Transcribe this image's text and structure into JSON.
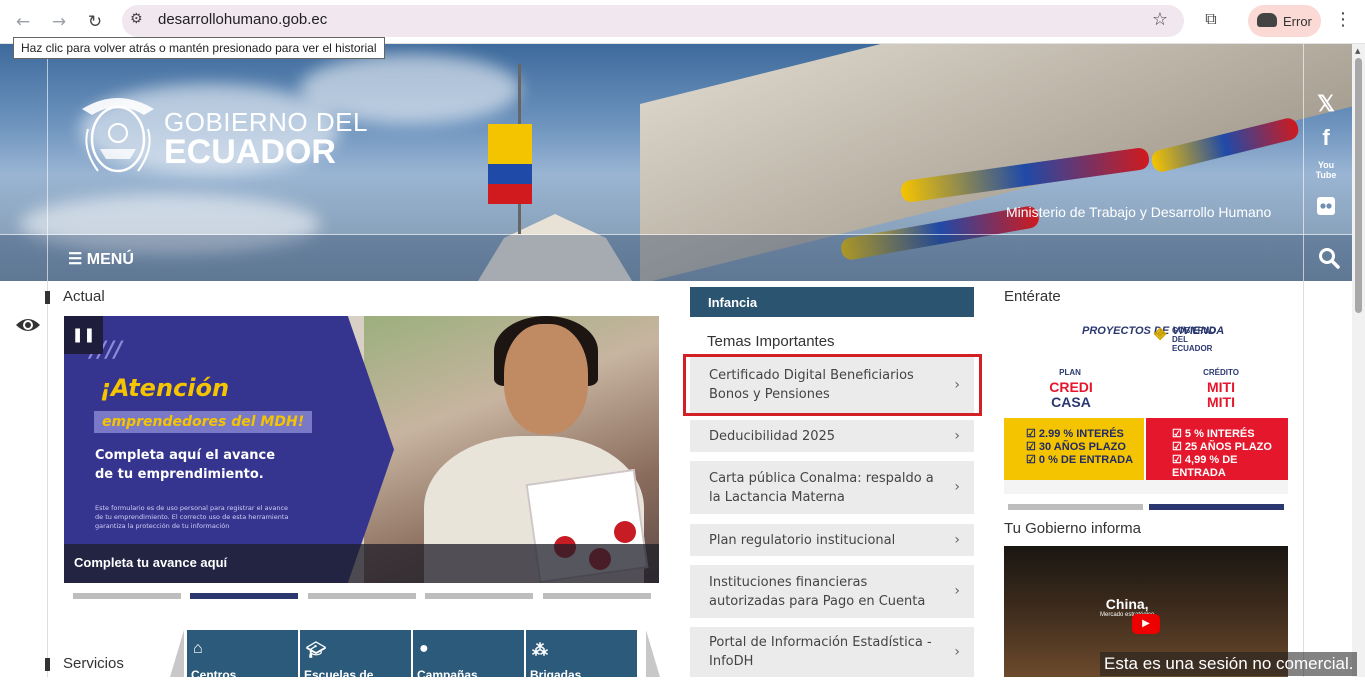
{
  "browser": {
    "url": "desarrollohumano.gob.ec",
    "profile_label": "Error",
    "tooltip": "Haz clic para volver atrás o mantén presionado para ver el historial"
  },
  "header": {
    "logo_line1": "GOBIERNO DEL",
    "logo_line2": "ECUADOR",
    "ministry": "Ministerio de Trabajo y Desarrollo Humano",
    "menu_label": "MENÚ",
    "social": [
      "x-icon",
      "facebook-icon",
      "youtube-icon",
      "flickr-icon"
    ]
  },
  "actual": {
    "title": "Actual",
    "slide": {
      "headline": "¡Atención",
      "subheadline": "emprendedores del MDH!",
      "body": "Completa aquí el avance de tu emprendimiento.",
      "fineprint": "Este formulario es de uso personal para registrar el avance de tu emprendimiento. El correcto uso de esta herramienta garantiza la protección de tu información",
      "caption": "Completa tu avance aquí"
    },
    "dots_active": 1
  },
  "servicios": {
    "title": "Servicios",
    "items": [
      {
        "label": "Centros",
        "icon": "building-icon"
      },
      {
        "label": "Escuelas de",
        "icon": "graduation-cap-icon"
      },
      {
        "label": "Campañas",
        "icon": "lightbulb-icon"
      },
      {
        "label": "Brigadas",
        "icon": "people-icon"
      }
    ]
  },
  "temas": {
    "tab": "Infancia",
    "title": "Temas Importantes",
    "links": [
      "Certificado Digital Beneficiarios Bonos y Pensiones",
      "Deducibilidad 2025",
      "Carta pública Conalma: respaldo a la Lactancia Materna",
      "Plan regulatorio institucional",
      "Instituciones financieras autorizadas para Pago en Cuenta",
      "Portal de Información Estadística - InfoDH"
    ]
  },
  "enterate": {
    "title": "Entérate",
    "ad": {
      "header_left": "PROYECTOS DE VIVIENDA",
      "header_right": "GOBIERNO DEL ECUADOR",
      "plan_top": "PLAN",
      "plan_main1": "CREDI",
      "plan_main2": "CASA",
      "credito_top": "CRÉDITO",
      "credito_main1": "MITI",
      "credito_main2": "MITI",
      "yellow_lines": [
        "☑ 2.99 % INTERÉS",
        "☑ 30 AÑOS PLAZO",
        "☑ 0 % DE ENTRADA"
      ],
      "red_lines": [
        "☑ 5 % INTERÉS",
        "☑ 25 AÑOS PLAZO",
        "☑ 4,99 % DE ENTRADA"
      ]
    },
    "dots_active": 1
  },
  "tu_gobierno": {
    "title": "Tu Gobierno informa",
    "video_title": "China,",
    "video_sub": "Mercado estratégico"
  },
  "session_notice": "Esta es una sesión no comercial.",
  "colors": {
    "navy": "#2b3870",
    "teal_blue": "#2b5471",
    "highlight_red": "#d32026",
    "ecuador_yellow": "#f5c400"
  }
}
